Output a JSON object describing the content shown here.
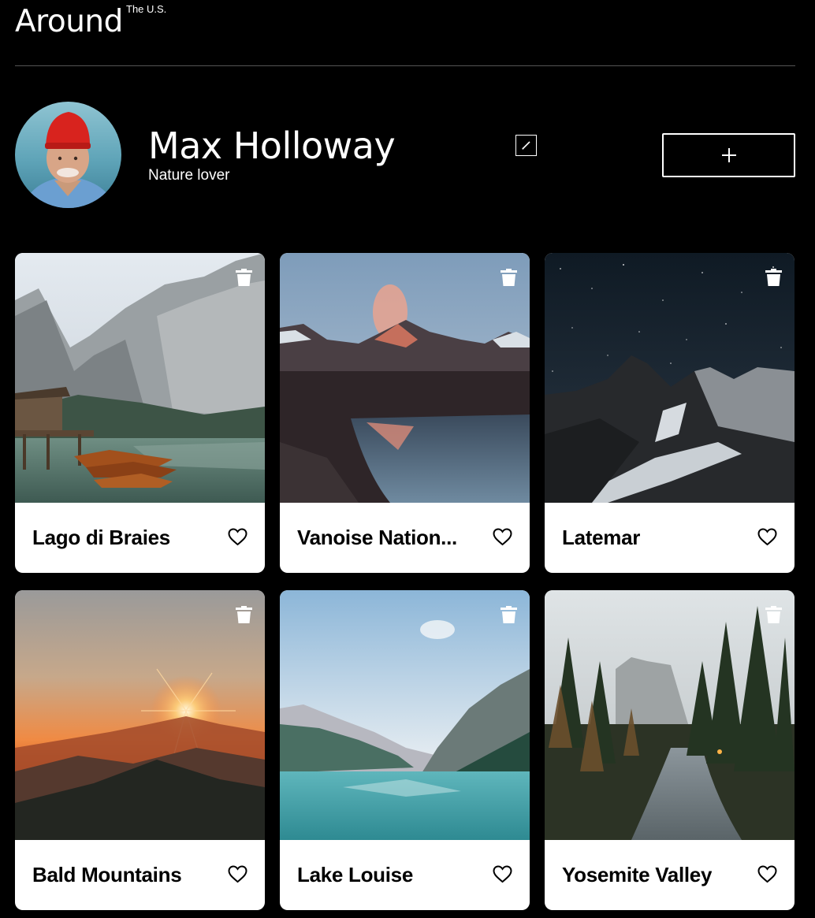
{
  "header": {
    "logo": "Around",
    "logo_sup": "The U.S."
  },
  "profile": {
    "name": "Max Holloway",
    "about": "Nature lover",
    "edit_icon": "pencil-icon",
    "add_icon": "plus-icon"
  },
  "cards": [
    {
      "title": "Lago di Braies",
      "scene": "lake-boats"
    },
    {
      "title": "Vanoise Nation...",
      "scene": "reflection-dusk"
    },
    {
      "title": "Latemar",
      "scene": "night-mountains"
    },
    {
      "title": "Bald Mountains",
      "scene": "sunset-hills"
    },
    {
      "title": "Lake Louise",
      "scene": "turquoise-lake"
    },
    {
      "title": "Yosemite Valley",
      "scene": "forest-river"
    }
  ],
  "icons": {
    "delete": "trash-icon",
    "like": "heart-icon"
  },
  "colors": {
    "background": "#000000",
    "card": "#ffffff",
    "text_dark": "#000000",
    "divider": "#545454"
  }
}
